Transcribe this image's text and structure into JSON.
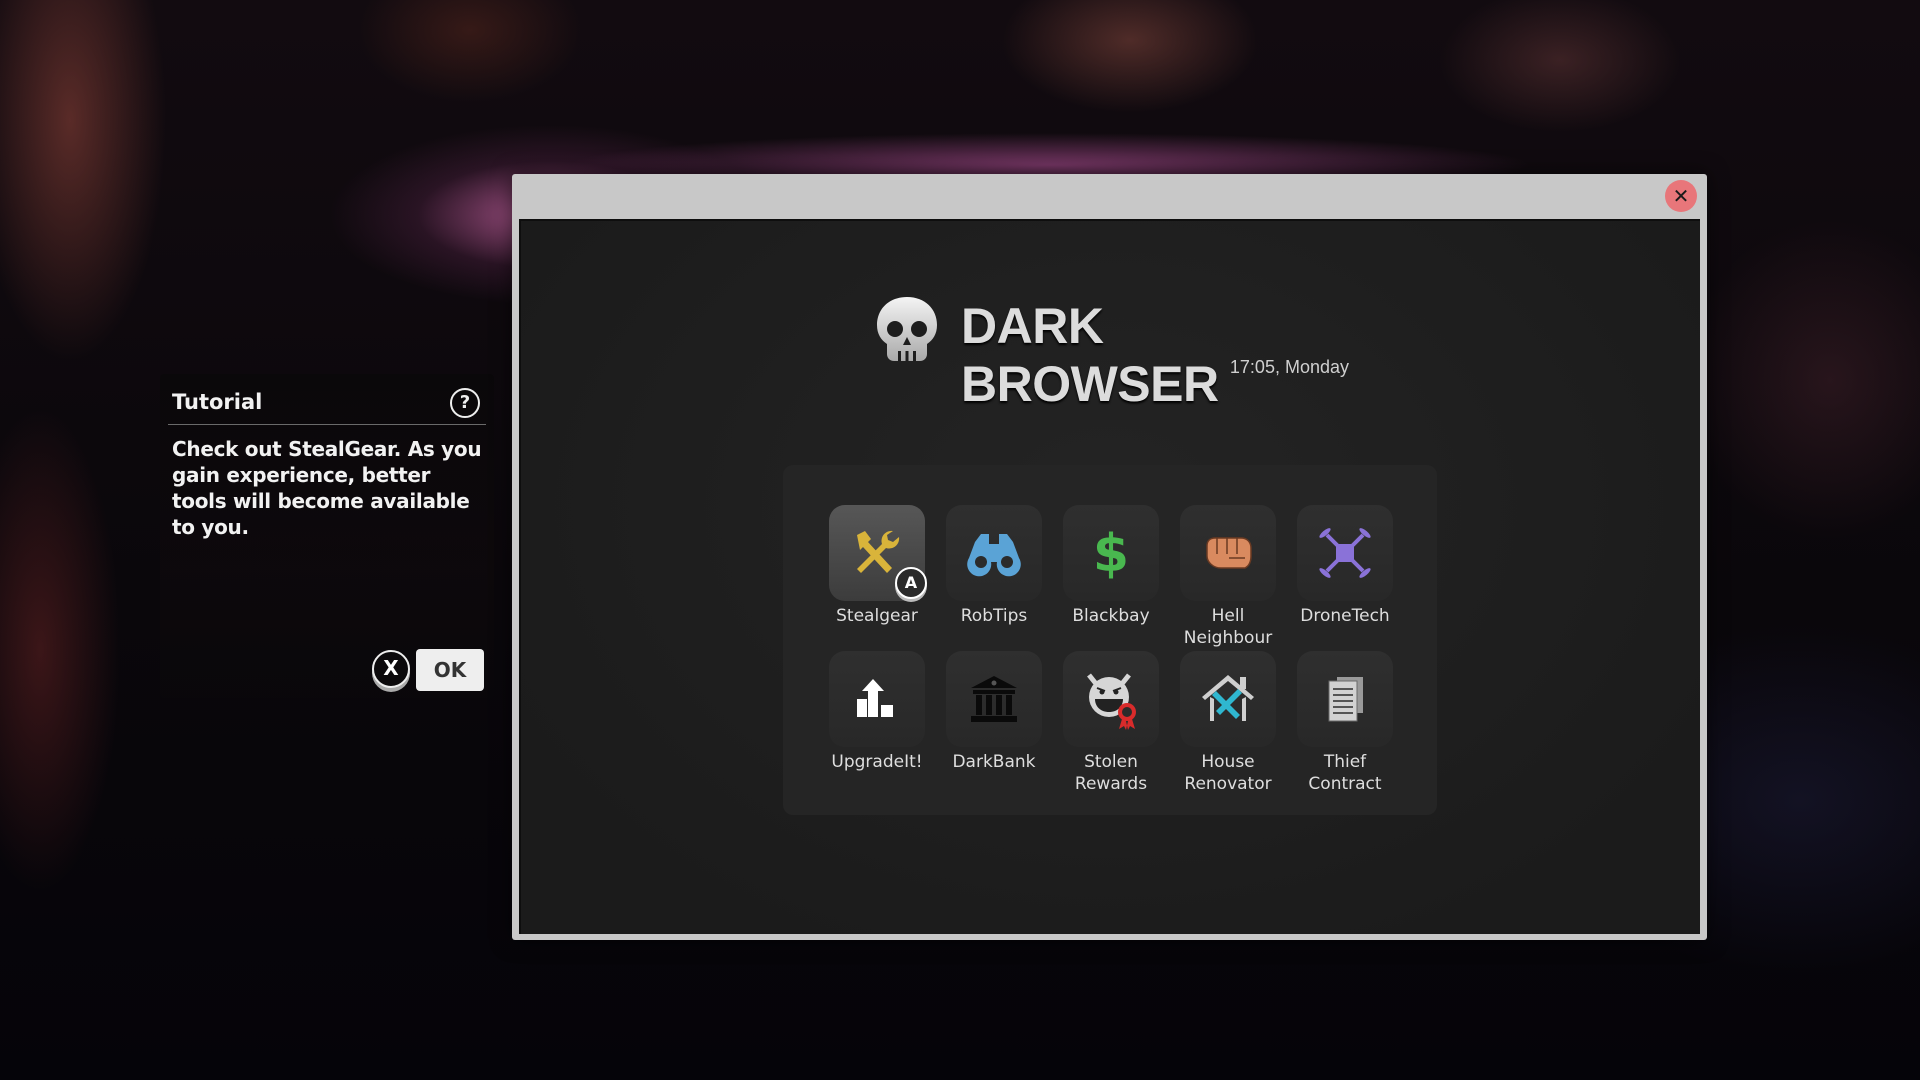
{
  "tutorial": {
    "title": "Tutorial",
    "help_icon": "question-circle-icon",
    "help_glyph": "?",
    "message": "Check out StealGear. As you gain experience, better tools will become available to you.",
    "dismiss_key": "X",
    "ok_label": "OK"
  },
  "window": {
    "close_glyph": "✕",
    "brand_icon": "skull-icon",
    "title": "DARK BROWSER",
    "clock": "17:05, Monday"
  },
  "apps": [
    {
      "label": "Stealgear",
      "icon": "tools-icon",
      "color": "#d9b43a",
      "selected": true,
      "controller_hint": "A"
    },
    {
      "label": "RobTips",
      "icon": "binoculars-icon",
      "color": "#5aa3d6"
    },
    {
      "label": "Blackbay",
      "icon": "dollar-icon",
      "color": "#49b84f"
    },
    {
      "label": "Hell Neighbour",
      "icon": "fist-icon",
      "color": "#d98a5f"
    },
    {
      "label": "DroneTech",
      "icon": "drone-icon",
      "color": "#8a72d8"
    },
    {
      "label": "UpgradeIt!",
      "icon": "upgrade-icon",
      "color": "#ffffff"
    },
    {
      "label": "DarkBank",
      "icon": "bank-icon",
      "color": "#0a0a0a"
    },
    {
      "label": "Stolen Rewards",
      "icon": "devil-award-icon",
      "color": "#d6d6d6",
      "accent": "#d92b2b"
    },
    {
      "label": "House Renovator",
      "icon": "house-tools-icon",
      "color": "#cfcfcf",
      "accent": "#2fb7d0"
    },
    {
      "label": "Thief Contract",
      "icon": "document-icon",
      "color": "#c8c8c8"
    }
  ]
}
